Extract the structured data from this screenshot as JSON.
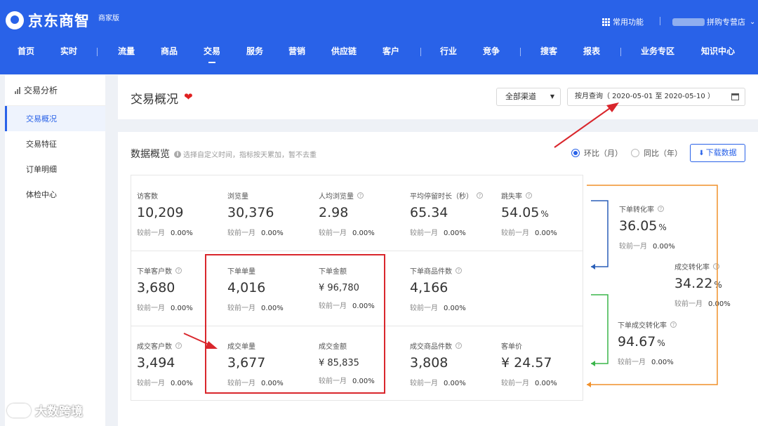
{
  "header": {
    "brand": "京东商智",
    "edition": "商家版",
    "common_functions": "常用功能",
    "store_suffix": "拼购专营店"
  },
  "nav": [
    {
      "label": "首页"
    },
    {
      "label": "实时"
    },
    {
      "label": "流量"
    },
    {
      "label": "商品"
    },
    {
      "label": "交易"
    },
    {
      "label": "服务"
    },
    {
      "label": "营销"
    },
    {
      "label": "供应链"
    },
    {
      "label": "客户"
    },
    {
      "label": "行业"
    },
    {
      "label": "竞争"
    },
    {
      "label": "搜客"
    },
    {
      "label": "报表"
    },
    {
      "label": "业务专区"
    },
    {
      "label": "知识中心"
    }
  ],
  "sidebar": {
    "heading": "交易分析",
    "items": [
      {
        "label": "交易概况"
      },
      {
        "label": "交易特征"
      },
      {
        "label": "订单明细"
      },
      {
        "label": "体检中心"
      }
    ]
  },
  "page": {
    "title": "交易概况",
    "channel": "全部渠道",
    "date_range": "按月查询（ 2020-05-01 至 2020-05-10 ）"
  },
  "overview": {
    "title": "数据概览",
    "hint": "选择自定义时间，指标按天累加，暂不去重",
    "option_mom": "环比（月）",
    "option_yoy": "同比（年）",
    "download": "下载数据",
    "compare_label": "较前一月",
    "rows": [
      [
        {
          "label": "访客数",
          "value": "10,209",
          "change": "0.00%"
        },
        {
          "label": "浏览量",
          "value": "30,376",
          "change": "0.00%"
        },
        {
          "label": "人均浏览量",
          "value": "2.98",
          "change": "0.00%"
        },
        {
          "label": "平均停留时长（秒）",
          "value": "65.34",
          "change": "0.00%"
        },
        {
          "label": "跳失率",
          "value": "54.05",
          "unit": "%",
          "change": "0.00%"
        }
      ],
      [
        {
          "label": "下单客户数",
          "value": "3,680",
          "change": "0.00%"
        },
        {
          "label": "下单单量",
          "value": "4,016",
          "change": "0.00%"
        },
        {
          "label": "下单金额",
          "value": "¥ 96,780",
          "change": "0.00%"
        },
        {
          "label": "下单商品件数",
          "value": "4,166",
          "change": "0.00%"
        }
      ],
      [
        {
          "label": "成交客户数",
          "value": "3,494",
          "change": "0.00%"
        },
        {
          "label": "成交单量",
          "value": "3,677",
          "change": "0.00%"
        },
        {
          "label": "成交金额",
          "value": "¥ 85,835",
          "change": "0.00%"
        },
        {
          "label": "成交商品件数",
          "value": "3,808",
          "change": "0.00%"
        },
        {
          "label": "客单价",
          "value": "¥ 24.57",
          "change": "0.00%"
        }
      ]
    ],
    "conversions": [
      {
        "label": "下单转化率",
        "value": "36.05",
        "unit": "%",
        "change": "0.00%"
      },
      {
        "label": "成交转化率",
        "value": "34.22",
        "unit": "%",
        "change": "0.00%"
      },
      {
        "label": "下单成交转化率",
        "value": "94.67",
        "unit": "%",
        "change": "0.00%"
      }
    ]
  },
  "watermark": "大数跨境",
  "colors": {
    "brand_blue": "#2962e8",
    "highlight_red": "#d9262c",
    "flow_blue": "#2a5fb8",
    "flow_green": "#3ab54a",
    "flow_orange": "#f0902a"
  }
}
